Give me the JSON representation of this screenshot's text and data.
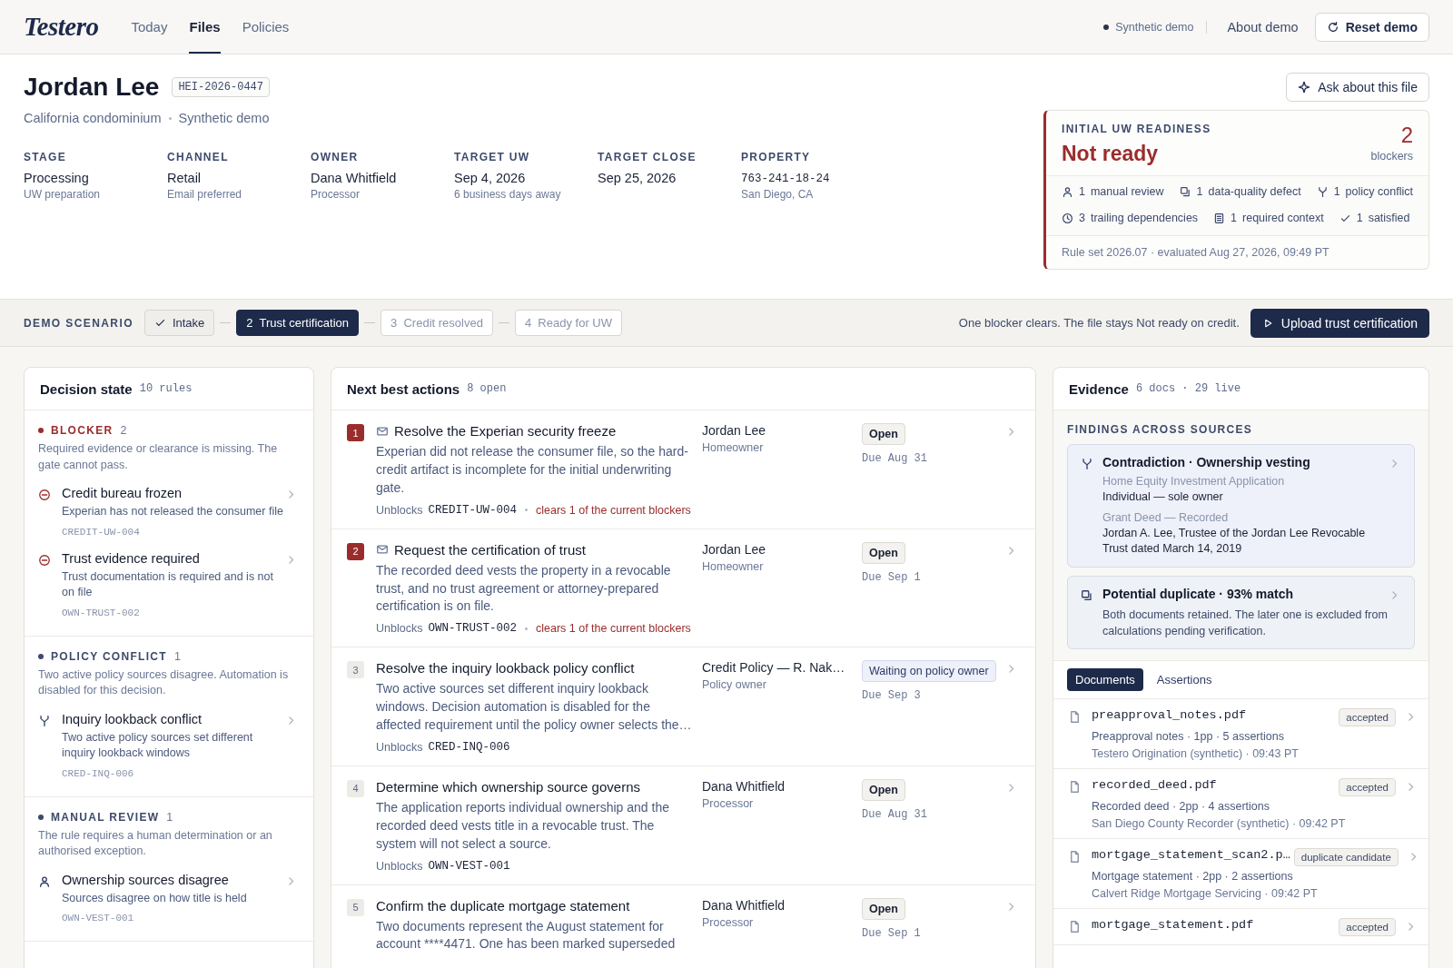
{
  "header": {
    "logo": "Testero",
    "nav": [
      {
        "label": "Today",
        "selected": false
      },
      {
        "label": "Files",
        "selected": true
      },
      {
        "label": "Policies",
        "selected": false
      }
    ],
    "status": "Synthetic demo",
    "about": "About demo",
    "reset": "Reset demo"
  },
  "file": {
    "name": "Jordan Lee",
    "id": "HEI-2026-0447",
    "subtitle": [
      "California condominium",
      "Synthetic demo"
    ],
    "ask": "Ask about this file",
    "facts": [
      {
        "kind": "text",
        "label": "STAGE",
        "value": "Processing",
        "note": "UW preparation"
      },
      {
        "kind": "text",
        "label": "CHANNEL",
        "value": "Retail",
        "note": "Email preferred"
      },
      {
        "kind": "text",
        "label": "OWNER",
        "value": "Dana Whitfield",
        "note": "Processor"
      },
      {
        "kind": "text",
        "label": "TARGET UW",
        "value": "Sep 4, 2026",
        "note": "6 business days away"
      },
      {
        "kind": "text",
        "label": "TARGET CLOSE",
        "value": "Sep 25, 2026"
      },
      {
        "kind": "code",
        "label": "PROPERTY",
        "value": "763-241-18-24",
        "note": "San Diego, CA"
      }
    ]
  },
  "readiness": {
    "title": "INITIAL UW READINESS",
    "status": "Not ready",
    "count": "2",
    "count_label": "blockers",
    "counts": [
      {
        "kind": "manual_review",
        "count": "1",
        "label": "manual review"
      },
      {
        "kind": "data_quality",
        "count": "1",
        "label": "data-quality defect"
      },
      {
        "kind": "policy_conflict",
        "count": "1",
        "label": "policy conflict"
      },
      {
        "kind": "trailing",
        "count": "3",
        "label": "trailing dependencies"
      },
      {
        "kind": "required_context",
        "count": "1",
        "label": "required context"
      },
      {
        "kind": "satisfied",
        "count": "1",
        "label": "satisfied"
      }
    ],
    "footer": "Rule set 2026.07 · evaluated Aug 27, 2026, 09:49 PT"
  },
  "scenario": {
    "label": "DEMO SCENARIO",
    "steps": [
      {
        "label": "Intake",
        "checked": true,
        "selected": false
      },
      {
        "number": "2",
        "label": "Trust certification",
        "checked": false,
        "selected": true
      },
      {
        "number": "3",
        "label": "Credit resolved",
        "checked": false,
        "selected": false
      },
      {
        "number": "4",
        "label": "Ready for UW",
        "checked": false,
        "selected": false
      }
    ],
    "note": "One blocker clears. The file stays Not ready on credit.",
    "action": "Upload trust certification"
  },
  "decision": {
    "title": "Decision state",
    "meta": "10 rules",
    "groups": [
      {
        "kind": "blocker",
        "label": "BLOCKER",
        "count": "2",
        "description": "Required evidence or clearance is missing. The gate cannot pass.",
        "items": [
          {
            "title": "Credit bureau frozen",
            "description": "Experian has not released the consumer file",
            "code": "CREDIT-UW-004"
          },
          {
            "title": "Trust evidence required",
            "description": "Trust documentation is required and is not on file",
            "code": "OWN-TRUST-002"
          }
        ]
      },
      {
        "kind": "policy_conflict",
        "label": "POLICY CONFLICT",
        "count": "1",
        "description": "Two active policy sources disagree. Automation is disabled for this decision.",
        "items": [
          {
            "title": "Inquiry lookback conflict",
            "description": "Two active policy sources set different inquiry lookback windows",
            "code": "CRED-INQ-006"
          }
        ]
      },
      {
        "kind": "manual_review",
        "label": "MANUAL REVIEW",
        "count": "1",
        "description": "The rule requires a human determination or an authorised exception.",
        "items": [
          {
            "title": "Ownership sources disagree",
            "description": "Sources disagree on how title is held",
            "code": "OWN-VEST-001"
          }
        ]
      }
    ]
  },
  "actions": {
    "title": "Next best actions",
    "meta": "8 open",
    "items": [
      {
        "number": "1",
        "blocker": true,
        "kind": "email",
        "title": "Resolve the Experian security freeze",
        "description": "Experian did not release the consumer file, so the hard-credit artifact is incomplete for the initial underwriting gate.",
        "unblocks_label": "Unblocks",
        "code": "CREDIT-UW-004",
        "effect": "clears 1 of the current blockers",
        "owner": "Jordan Lee",
        "role": "Homeowner",
        "status": "Open",
        "waiting": false,
        "due": "Due Aug 31"
      },
      {
        "number": "2",
        "blocker": true,
        "kind": "email",
        "title": "Request the certification of trust",
        "description": "The recorded deed vests the property in a revocable trust, and no trust agreement or attorney-prepared certification is on file.",
        "unblocks_label": "Unblocks",
        "code": "OWN-TRUST-002",
        "effect": "clears 1 of the current blockers",
        "owner": "Jordan Lee",
        "role": "Homeowner",
        "status": "Open",
        "waiting": false,
        "due": "Due Sep 1"
      },
      {
        "number": "3",
        "blocker": false,
        "kind": "task",
        "title": "Resolve the inquiry lookback policy conflict",
        "description": "Two active sources set different inquiry lookback windows. Decision automation is disabled for the affected requirement until the policy owner selects the…",
        "unblocks_label": "Unblocks",
        "code": "CRED-INQ-006",
        "owner": "Credit Policy — R. Nak…",
        "role": "Policy owner",
        "status": "Waiting on policy owner",
        "waiting": true,
        "due": "Due Sep 3"
      },
      {
        "number": "4",
        "blocker": false,
        "kind": "task",
        "title": "Determine which ownership source governs",
        "description": "The application reports individual ownership and the recorded deed vests title in a revocable trust. The system will not select a source.",
        "unblocks_label": "Unblocks",
        "code": "OWN-VEST-001",
        "owner": "Dana Whitfield",
        "role": "Processor",
        "status": "Open",
        "waiting": false,
        "due": "Due Aug 31"
      },
      {
        "number": "5",
        "blocker": false,
        "kind": "task",
        "title": "Confirm the duplicate mortgage statement",
        "description": "Two documents represent the August statement for account ****4471. One has been marked superseded",
        "owner": "Dana Whitfield",
        "role": "Processor",
        "status": "Open",
        "waiting": false,
        "due": "Due Sep 1"
      }
    ]
  },
  "evidence": {
    "title": "Evidence",
    "meta": "6 docs · 29 live",
    "findings_title": "FINDINGS ACROSS SOURCES",
    "findings": [
      {
        "kind": "contradiction",
        "title": "Contradiction · Ownership vesting",
        "sources": [
          {
            "source": "Home Equity Investment Application",
            "value": "Individual — sole owner"
          },
          {
            "source": "Grant Deed — Recorded",
            "value": "Jordan A. Lee, Trustee of the Jordan Lee Revocable Trust dated March 14, 2019"
          }
        ]
      },
      {
        "kind": "duplicate",
        "title": "Potential duplicate · 93% match",
        "description": "Both documents retained. The later one is excluded from calculations pending verification."
      }
    ],
    "tabs": [
      {
        "label": "Documents",
        "selected": true
      },
      {
        "label": "Assertions",
        "selected": false
      }
    ],
    "documents": [
      {
        "filename": "preapproval_notes.pdf",
        "status": "accepted",
        "details": "Preapproval notes · 1pp · 5 assertions",
        "source": "Testero Origination (synthetic) · 09:43 PT"
      },
      {
        "filename": "recorded_deed.pdf",
        "status": "accepted",
        "details": "Recorded deed · 2pp · 4 assertions",
        "source": "San Diego County Recorder (synthetic) · 09:42 PT"
      },
      {
        "filename": "mortgage_statement_scan2.p…",
        "status": "duplicate candidate",
        "details": "Mortgage statement · 2pp · 2 assertions",
        "source": "Calvert Ridge Mortgage Servicing · 09:42 PT"
      },
      {
        "filename": "mortgage_statement.pdf",
        "status": "accepted"
      }
    ]
  }
}
